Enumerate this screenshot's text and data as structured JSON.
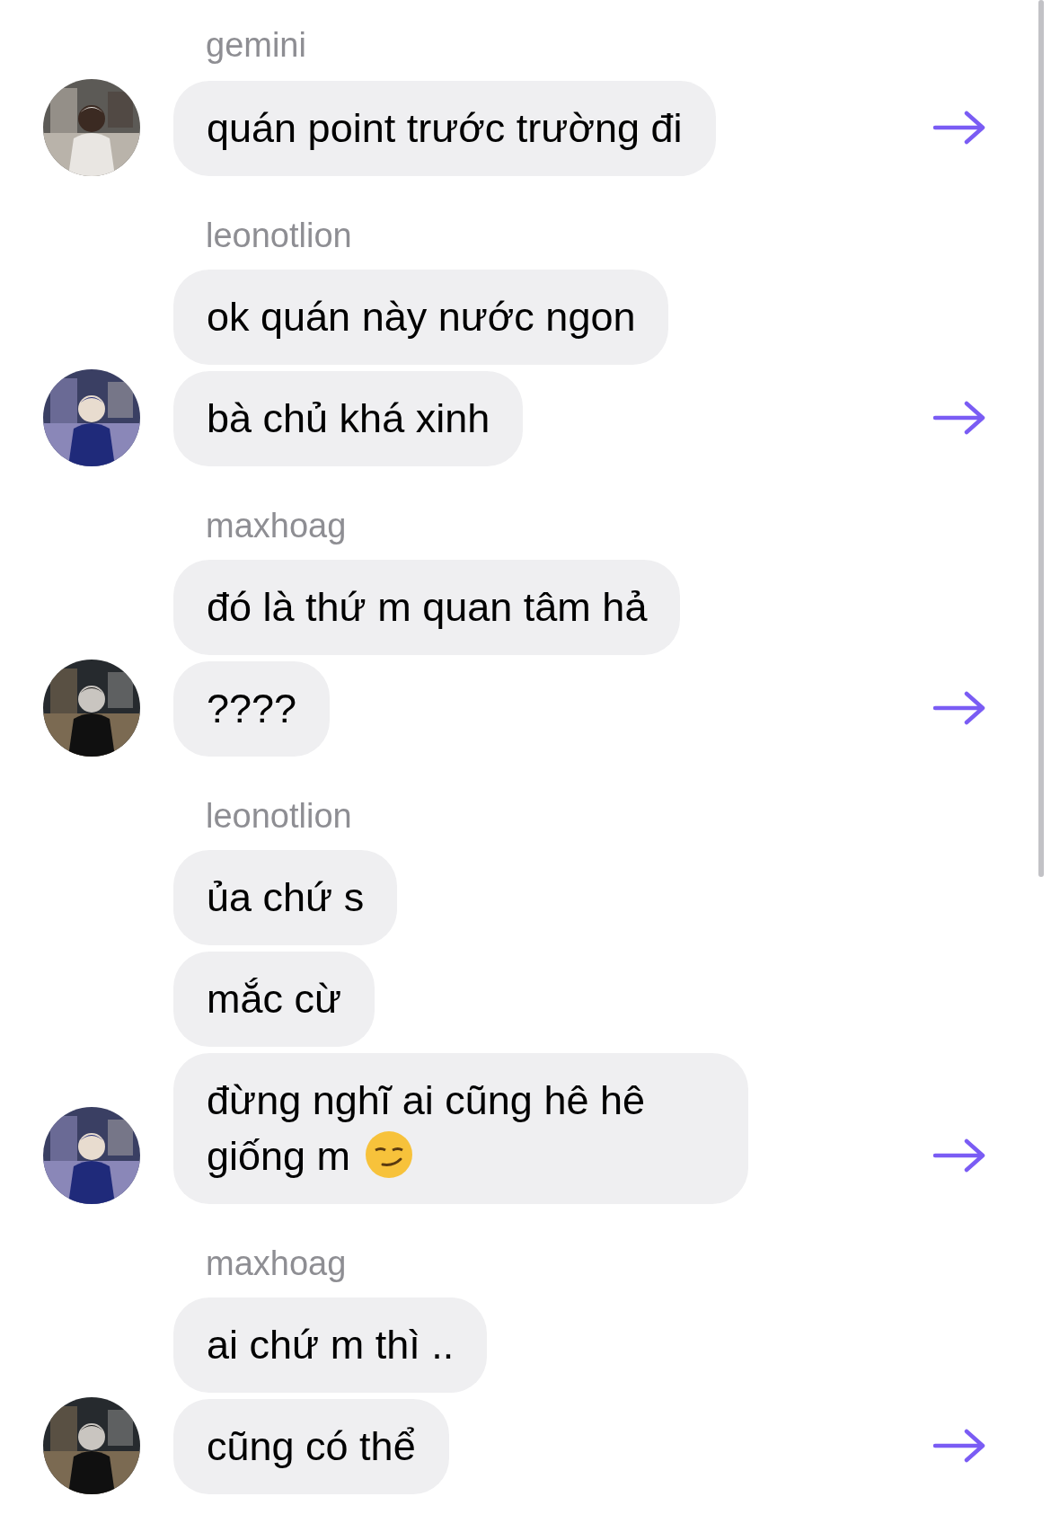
{
  "groups": [
    {
      "sender": "gemini",
      "messages": [
        {
          "kind": "text",
          "text": "quán point trước trường đi"
        }
      ]
    },
    {
      "sender": "leonotlion",
      "messages": [
        {
          "kind": "text",
          "text": "ok quán này nước ngon"
        },
        {
          "kind": "text",
          "text": "bà chủ khá xinh"
        }
      ]
    },
    {
      "sender": "maxhoag",
      "messages": [
        {
          "kind": "text",
          "text": "đó là thứ m quan tâm hả"
        },
        {
          "kind": "text",
          "text": "????"
        }
      ]
    },
    {
      "sender": "leonotlion",
      "messages": [
        {
          "kind": "text",
          "text": "ủa chứ s"
        },
        {
          "kind": "text",
          "text": "mắc cừ"
        },
        {
          "kind": "text_with_smirk",
          "text": "đừng nghĩ ai cũng hê hê giống m"
        }
      ]
    },
    {
      "sender": "maxhoag",
      "messages": [
        {
          "kind": "text",
          "text": "ai chứ m thì .."
        },
        {
          "kind": "text",
          "text": "cũng có thể"
        }
      ]
    }
  ]
}
